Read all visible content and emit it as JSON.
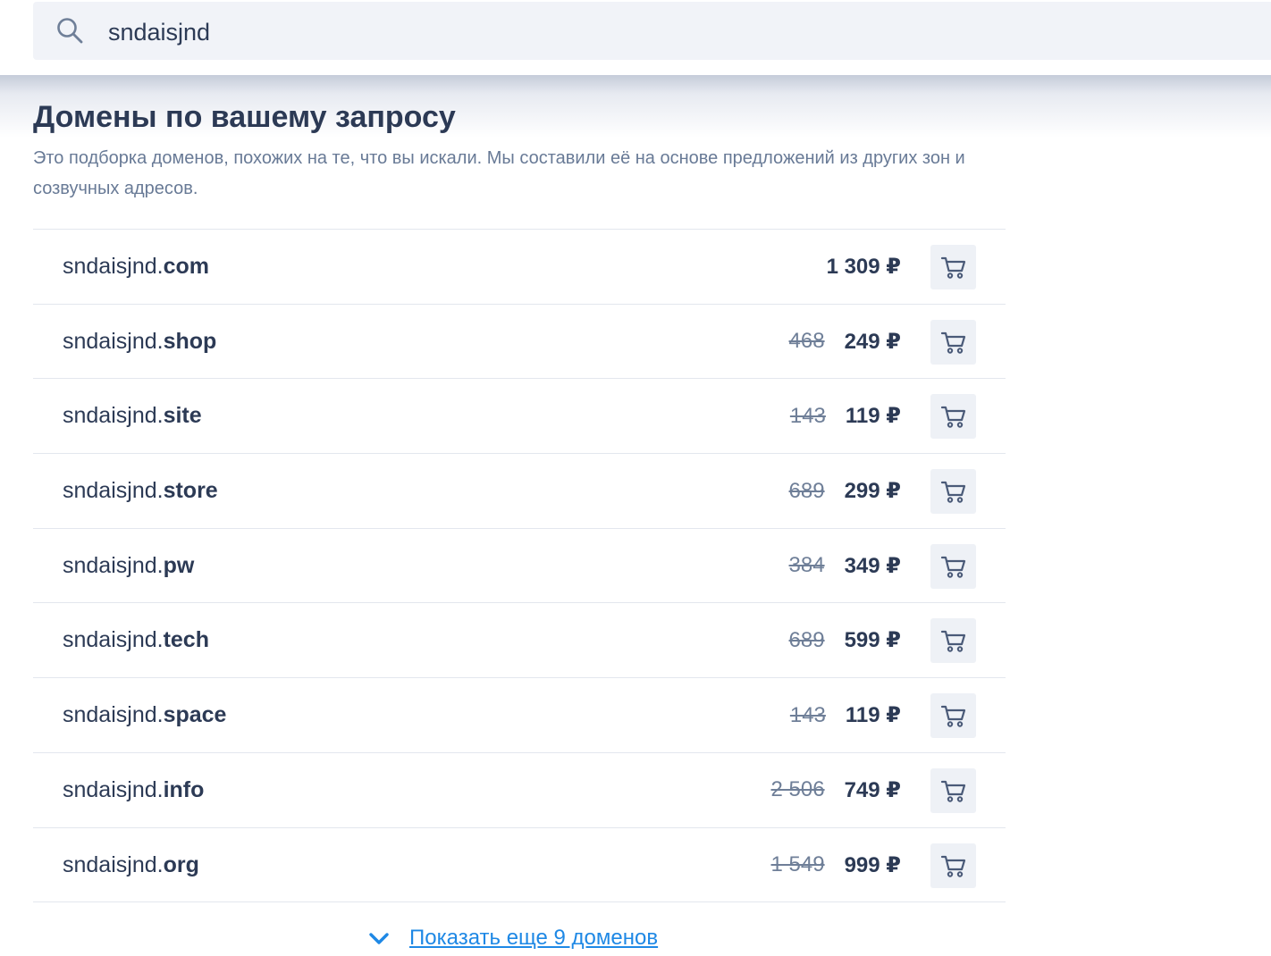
{
  "search": {
    "value": "sndaisjnd"
  },
  "section": {
    "title": "Домены по вашему запросу",
    "description": "Это подборка доменов, похожих на те, что вы искали. Мы составили её на основе предложений из других зон и созвучных адресов."
  },
  "domains": [
    {
      "name": "sndaisjnd.",
      "zone": "com",
      "old_price": "",
      "price": "1 309 ₽"
    },
    {
      "name": "sndaisjnd.",
      "zone": "shop",
      "old_price": "468",
      "price": "249 ₽"
    },
    {
      "name": "sndaisjnd.",
      "zone": "site",
      "old_price": "143",
      "price": "119 ₽"
    },
    {
      "name": "sndaisjnd.",
      "zone": "store",
      "old_price": "689",
      "price": "299 ₽"
    },
    {
      "name": "sndaisjnd.",
      "zone": "pw",
      "old_price": "384",
      "price": "349 ₽"
    },
    {
      "name": "sndaisjnd.",
      "zone": "tech",
      "old_price": "689",
      "price": "599 ₽"
    },
    {
      "name": "sndaisjnd.",
      "zone": "space",
      "old_price": "143",
      "price": "119 ₽"
    },
    {
      "name": "sndaisjnd.",
      "zone": "info",
      "old_price": "2 506",
      "price": "749 ₽"
    },
    {
      "name": "sndaisjnd.",
      "zone": "org",
      "old_price": "1 549",
      "price": "999 ₽"
    }
  ],
  "show_more": {
    "label": "Показать еще 9 доменов"
  },
  "icons": {
    "search": "search-icon",
    "cart": "cart-icon",
    "chevron": "chevron-down-icon"
  },
  "colors": {
    "accent": "#1e88e5",
    "text": "#2c3a55",
    "muted": "#687a96",
    "button_bg": "#eef1f6"
  }
}
